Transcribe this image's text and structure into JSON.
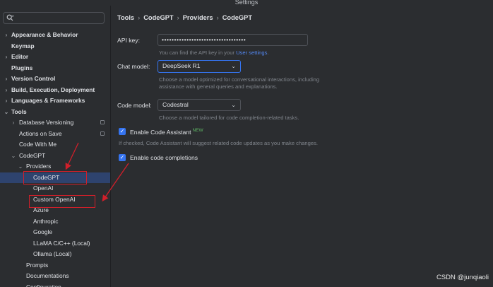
{
  "window": {
    "title": "Settings"
  },
  "sidebar": {
    "search_placeholder": "",
    "items": [
      {
        "label": "Appearance & Behavior",
        "arrow": "›",
        "bold": true
      },
      {
        "label": "Keymap",
        "arrow": "",
        "bold": true
      },
      {
        "label": "Editor",
        "arrow": "›",
        "bold": true
      },
      {
        "label": "Plugins",
        "arrow": "",
        "bold": true
      },
      {
        "label": "Version Control",
        "arrow": "›",
        "bold": true
      },
      {
        "label": "Build, Execution, Deployment",
        "arrow": "›",
        "bold": true
      },
      {
        "label": "Languages & Frameworks",
        "arrow": "›",
        "bold": true
      },
      {
        "label": "Tools",
        "arrow": "⌄",
        "bold": true
      },
      {
        "label": "Database Versioning",
        "arrow": "›",
        "bold": false
      },
      {
        "label": "Actions on Save",
        "arrow": "",
        "bold": false
      },
      {
        "label": "Code With Me",
        "arrow": "",
        "bold": false
      },
      {
        "label": "CodeGPT",
        "arrow": "⌄",
        "bold": false
      },
      {
        "label": "Providers",
        "arrow": "⌄",
        "bold": false
      },
      {
        "label": "CodeGPT",
        "arrow": "",
        "bold": false
      },
      {
        "label": "OpenAI",
        "arrow": "",
        "bold": false
      },
      {
        "label": "Custom OpenAI",
        "arrow": "",
        "bold": false
      },
      {
        "label": "Azure",
        "arrow": "",
        "bold": false
      },
      {
        "label": "Anthropic",
        "arrow": "",
        "bold": false
      },
      {
        "label": "Google",
        "arrow": "",
        "bold": false
      },
      {
        "label": "LLaMA C/C++ (Local)",
        "arrow": "",
        "bold": false
      },
      {
        "label": "Ollama (Local)",
        "arrow": "",
        "bold": false
      },
      {
        "label": "Prompts",
        "arrow": "",
        "bold": false
      },
      {
        "label": "Documentations",
        "arrow": "",
        "bold": false
      },
      {
        "label": "Configuration",
        "arrow": "",
        "bold": false
      }
    ]
  },
  "breadcrumb": [
    "Tools",
    "CodeGPT",
    "Providers",
    "CodeGPT"
  ],
  "form": {
    "api_key_label": "API key:",
    "api_key_value": "••••••••••••••••••••••••••••••••••",
    "api_key_hint_prefix": "You can find the API key in your ",
    "api_key_hint_link": "User settings",
    "api_key_hint_suffix": ".",
    "chat_model_label": "Chat model:",
    "chat_model_value": "DeepSeek R1",
    "chat_model_hint_1": "Choose a model optimized for conversational interactions, including",
    "chat_model_hint_2": "assistance with general queries and explanations.",
    "code_model_label": "Code model:",
    "code_model_value": "Codestral",
    "code_model_hint": "Choose a model tailored for code completion-related tasks.",
    "assistant_label": "Enable Code Assistant",
    "assistant_badge": "NEW",
    "assistant_checked": true,
    "assistant_hint": "If checked, Code Assistant will suggest related code updates as you make changes.",
    "completions_label": "Enable code completions",
    "completions_checked": true
  },
  "watermark": "CSDN @junqiaoli",
  "colors": {
    "accent": "#3574f0",
    "highlight": "#d11f2a",
    "link": "#548af7"
  },
  "icons": {
    "search": "search-icon",
    "checkmark": "checkmark-icon",
    "chevron": "chevron-down-icon"
  }
}
